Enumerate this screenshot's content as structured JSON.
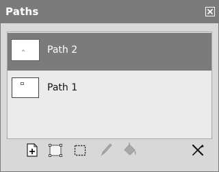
{
  "panel": {
    "title": "Paths",
    "close_icon": "close-icon"
  },
  "paths": [
    {
      "label": "Path 2",
      "selected": true,
      "thumbnail_icon": "path-thumbnail"
    },
    {
      "label": "Path 1",
      "selected": false,
      "thumbnail_icon": "path-thumbnail"
    }
  ],
  "toolbar": {
    "tools": [
      {
        "name": "new-path",
        "icon": "new-path-icon",
        "enabled": true
      },
      {
        "name": "path-to-selection",
        "icon": "path-to-selection-icon",
        "enabled": true
      },
      {
        "name": "selection-to-path",
        "icon": "selection-to-path-icon",
        "enabled": true
      },
      {
        "name": "stroke-path",
        "icon": "stroke-path-icon",
        "enabled": false
      },
      {
        "name": "fill-path",
        "icon": "fill-path-icon",
        "enabled": false
      },
      {
        "name": "delete-path",
        "icon": "delete-path-icon",
        "enabled": true
      }
    ]
  },
  "colors": {
    "titlebar": "#7b7b7b",
    "selected_row": "#7b7b7b",
    "list_background": "#ebebeb",
    "panel_background": "#d8d8d8",
    "disabled_icon": "#a0a0a0"
  }
}
